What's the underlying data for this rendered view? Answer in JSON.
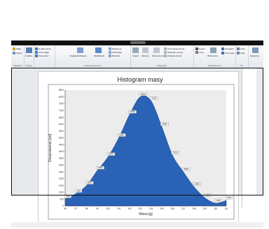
{
  "ribbon": {
    "groups": [
      {
        "label": "Clipboard",
        "items": [
          {
            "label": "Wklej"
          },
          {
            "label": "Kopiuj"
          }
        ]
      },
      {
        "label": "Dodaj",
        "items": [
          {
            "label": "Grafika"
          }
        ]
      },
      {
        "label": "",
        "items": [
          {
            "label": "Dodaj wykres"
          },
          {
            "label": "Linia ciągła"
          },
          {
            "label": "Komentarz"
          }
        ]
      },
      {
        "label": "Ustawienia strony",
        "items": [
          {
            "label": "Nagłówek/Stopka"
          },
          {
            "label": "Skala/Kroki"
          },
          {
            "label": "Marginesy"
          },
          {
            "label": "Orientacja"
          },
          {
            "label": "Rozmiar"
          }
        ]
      },
      {
        "label": "Nawigacja",
        "items": [
          {
            "label": "Znajdź"
          },
          {
            "label": "Zamknij"
          },
          {
            "label": "Pierwsza strona"
          },
          {
            "label": "Poprzednia strona"
          },
          {
            "label": "Następna strona"
          },
          {
            "label": "Ostatnia strona"
          }
        ]
      },
      {
        "label": "Powiększenie",
        "items": [
          {
            "label": "Kursor"
          },
          {
            "label": "Lupa"
          },
          {
            "label": "Wiele stron"
          },
          {
            "label": "Powiększ"
          },
          {
            "label": "Pomniejsz"
          }
        ]
      },
      {
        "label": "Tło",
        "items": [
          {
            "label": "Kolor"
          },
          {
            "label": "Znak"
          }
        ]
      },
      {
        "label": "",
        "items": [
          {
            "label": "Eksportuj"
          }
        ]
      }
    ]
  },
  "colors": {
    "bar": "#2a62b6",
    "plot_bg": "#ececec",
    "chart_frame": "#8a8a8a"
  },
  "chart_data": {
    "type": "area",
    "title": "Histogram masy",
    "xlabel": "Masa [g]",
    "ylabel": "Oszacowanie [szt]",
    "x": [
      96,
      97,
      98,
      99,
      100,
      101,
      102,
      103,
      104,
      105,
      106,
      107,
      108,
      109,
      110,
      111
    ],
    "x_ticks": [
      "96",
      "97",
      "98",
      "99",
      "100",
      "101",
      "102",
      "103",
      "104",
      "105",
      "106",
      "107",
      "108",
      "109",
      "110",
      "111"
    ],
    "y": [
      500,
      900,
      1500,
      2600,
      3600,
      5000,
      6700,
      8000,
      7700,
      5800,
      3700,
      2500,
      1400,
      600,
      200,
      400
    ],
    "data_labels": [
      "500",
      "900",
      "1500",
      "2600",
      "3600",
      "5000",
      "6700",
      "8000",
      "7700",
      "5800",
      "3700",
      "2500",
      "1400",
      "600",
      "200",
      "400"
    ],
    "y_ticks": [
      "0",
      "500",
      "1000",
      "1500",
      "2000",
      "2500",
      "3000",
      "3500",
      "4000",
      "4500",
      "5000",
      "5500",
      "6000",
      "6500",
      "7000",
      "7500",
      "8000",
      "8500"
    ],
    "ylim": [
      0,
      8500
    ],
    "xlim": [
      96,
      111
    ],
    "grid": false,
    "legend": "none"
  },
  "statusbar": {
    "left": "",
    "right": ""
  }
}
